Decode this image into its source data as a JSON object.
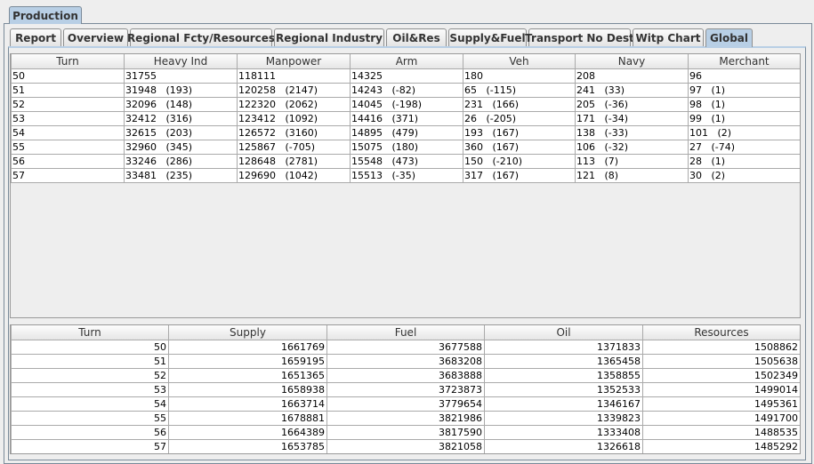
{
  "outer_tab": "Production",
  "tabs": [
    "Report",
    "Overview",
    "Regional Fcty/Resources",
    "Regional Industry",
    "Oil&Res",
    "Supply&Fuel",
    "Transport No Dest",
    "Witp Chart",
    "Global"
  ],
  "active_tab": "Global",
  "production_table": {
    "columns": [
      "Turn",
      "Heavy Ind",
      "Manpower",
      "Arm",
      "Veh",
      "Navy",
      "Merchant"
    ],
    "rows": [
      [
        "50",
        "31755",
        "118111",
        "14325",
        "180",
        "208",
        "96"
      ],
      [
        "51",
        "31948   (193)",
        "120258   (2147)",
        "14243   (-82)",
        "65   (-115)",
        "241   (33)",
        "97   (1)"
      ],
      [
        "52",
        "32096   (148)",
        "122320   (2062)",
        "14045   (-198)",
        "231   (166)",
        "205   (-36)",
        "98   (1)"
      ],
      [
        "53",
        "32412   (316)",
        "123412   (1092)",
        "14416   (371)",
        "26   (-205)",
        "171   (-34)",
        "99   (1)"
      ],
      [
        "54",
        "32615   (203)",
        "126572   (3160)",
        "14895   (479)",
        "193   (167)",
        "138   (-33)",
        "101   (2)"
      ],
      [
        "55",
        "32960   (345)",
        "125867   (-705)",
        "15075   (180)",
        "360   (167)",
        "106   (-32)",
        "27   (-74)"
      ],
      [
        "56",
        "33246   (286)",
        "128648   (2781)",
        "15548   (473)",
        "150   (-210)",
        "113   (7)",
        "28   (1)"
      ],
      [
        "57",
        "33481   (235)",
        "129690   (1042)",
        "15513   (-35)",
        "317   (167)",
        "121   (8)",
        "30   (2)"
      ]
    ]
  },
  "resources_table": {
    "columns": [
      "Turn",
      "Supply",
      "Fuel",
      "Oil",
      "Resources"
    ],
    "rows": [
      [
        "50",
        "1661769",
        "3677588",
        "1371833",
        "1508862"
      ],
      [
        "51",
        "1659195",
        "3683208",
        "1365458",
        "1505638"
      ],
      [
        "52",
        "1651365",
        "3683888",
        "1358855",
        "1502349"
      ],
      [
        "53",
        "1658938",
        "3723873",
        "1352533",
        "1499014"
      ],
      [
        "54",
        "1663714",
        "3779654",
        "1346167",
        "1495361"
      ],
      [
        "55",
        "1678881",
        "3821986",
        "1339823",
        "1491700"
      ],
      [
        "56",
        "1664389",
        "3817590",
        "1333408",
        "1488535"
      ],
      [
        "57",
        "1653785",
        "3821058",
        "1326618",
        "1485292"
      ]
    ]
  }
}
